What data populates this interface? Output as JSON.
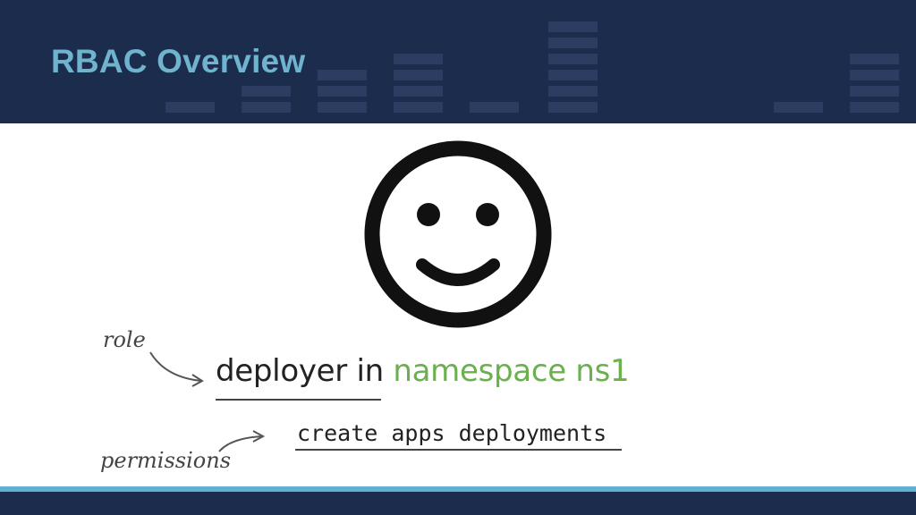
{
  "slide": {
    "title": "RBAC Overview",
    "role_word": "deployer",
    "in_word": " in ",
    "namespace_text": "namespace ns1",
    "permissions_text": "create apps deployments",
    "annotation_role": "role",
    "annotation_permissions": "permissions",
    "icon": "smiley-face-icon"
  },
  "colors": {
    "header_bg": "#1c2c4c",
    "title": "#6fb3cf",
    "namespace": "#6ab04c",
    "footer_accent": "#5fb0d3"
  }
}
